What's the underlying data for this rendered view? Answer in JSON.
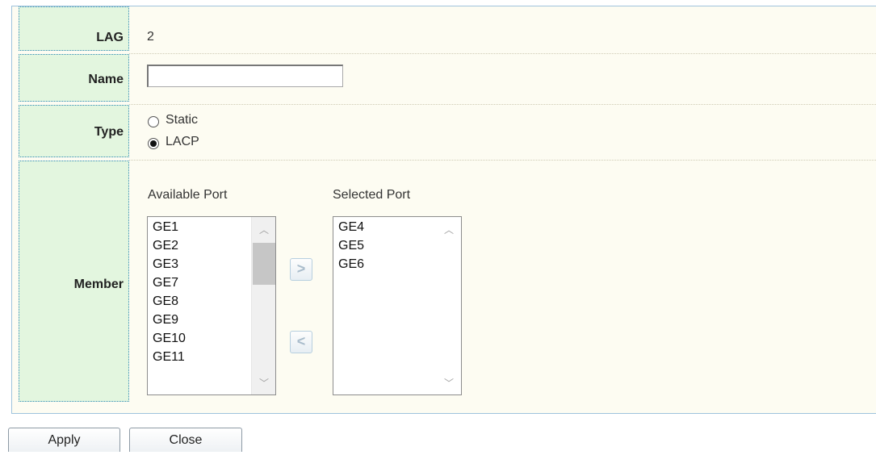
{
  "form": {
    "lag": {
      "label": "LAG",
      "value": "2"
    },
    "name": {
      "label": "Name",
      "value": "",
      "placeholder": ""
    },
    "type": {
      "label": "Type",
      "options": [
        "Static",
        "LACP"
      ],
      "selected": "LACP"
    },
    "member": {
      "label": "Member",
      "available_title": "Available Port",
      "selected_title": "Selected Port",
      "available_ports": [
        "GE1",
        "GE2",
        "GE3",
        "GE7",
        "GE8",
        "GE9",
        "GE10",
        "GE11"
      ],
      "selected_ports": [
        "GE4",
        "GE5",
        "GE6"
      ],
      "add_glyph": ">",
      "remove_glyph": "<"
    }
  },
  "buttons": {
    "apply": "Apply",
    "close": "Close"
  }
}
